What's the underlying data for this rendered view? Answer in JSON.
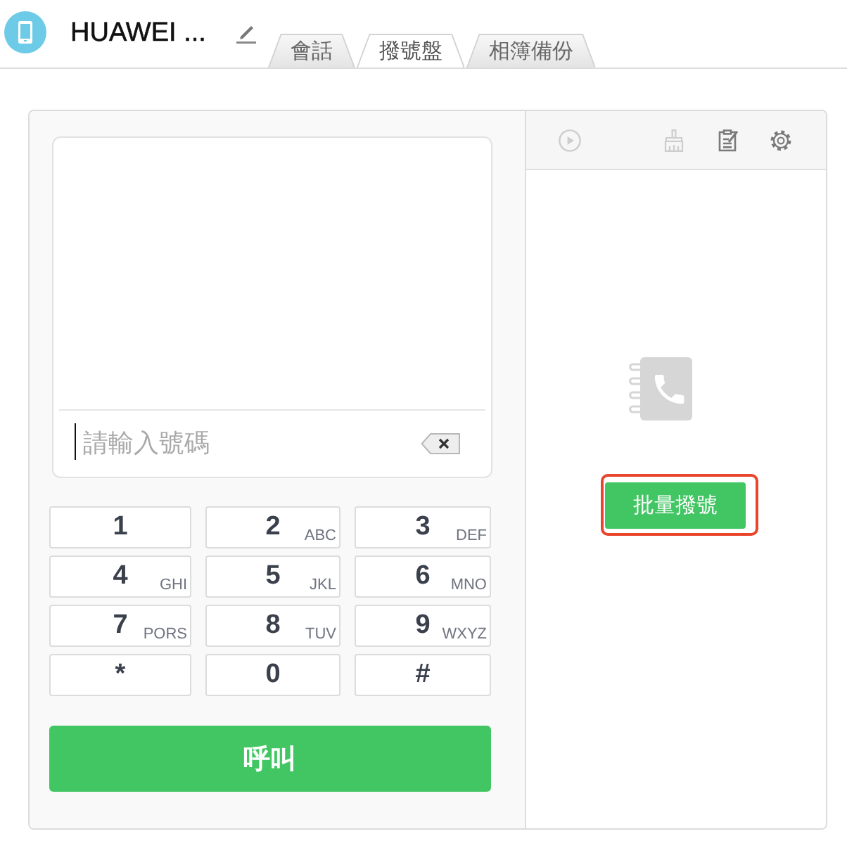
{
  "header": {
    "title": "HUAWEI ..."
  },
  "tabs": [
    {
      "label": "會話",
      "selected": false
    },
    {
      "label": "撥號盤",
      "selected": true
    },
    {
      "label": "相簿備份",
      "selected": false
    }
  ],
  "dialer": {
    "number_field": {
      "placeholder": "請輸入號碼"
    },
    "keys": [
      {
        "digit": "1"
      },
      {
        "digit": "2",
        "letters": "ABC"
      },
      {
        "digit": "3",
        "letters": "DEF"
      },
      {
        "digit": "4",
        "letters": "GHI"
      },
      {
        "digit": "5",
        "letters": "JKL"
      },
      {
        "digit": "6",
        "letters": "MNO"
      },
      {
        "digit": "7",
        "letters": "PORS"
      },
      {
        "digit": "8",
        "letters": "TUV"
      },
      {
        "digit": "9",
        "letters": "WXYZ"
      },
      {
        "digit": "*"
      },
      {
        "digit": "0"
      },
      {
        "digit": "#"
      }
    ],
    "call_button": "呼叫"
  },
  "side_panel": {
    "toolbar": [
      {
        "kind": "play",
        "disabled": true
      },
      {
        "kind": "brush",
        "disabled": true
      },
      {
        "kind": "notes",
        "disabled": false
      },
      {
        "kind": "settings",
        "disabled": false
      }
    ],
    "batch_dial_button": {
      "label": "批量撥號",
      "highlighted": true
    }
  }
}
